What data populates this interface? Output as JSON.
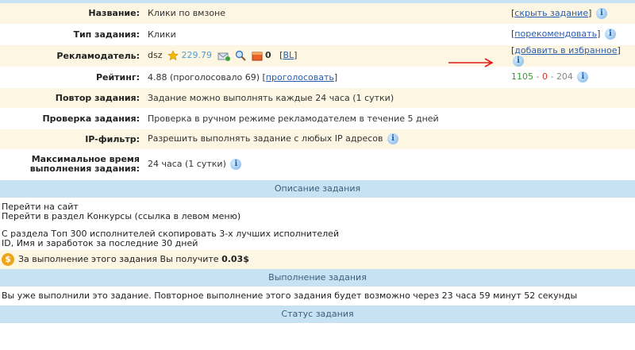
{
  "rows": {
    "name": {
      "label": "Название:",
      "value": "Клики по вмзоне",
      "action": "скрыть задание"
    },
    "type": {
      "label": "Тип задания:",
      "value": "Клики",
      "action": "порекомендовать"
    },
    "advertiser": {
      "label": "Рекламодатель:",
      "name": "dsz",
      "rating": "229.79",
      "count": "0",
      "bl": "BL",
      "action": "добавить в избранное"
    },
    "rating": {
      "label": "Рейтинг:",
      "value": "4.88 (проголосовало 69) [",
      "vote": "проголосовать",
      "close": "]",
      "pos": "1105",
      "sep1": " - ",
      "zero": "0",
      "sep2": " - ",
      "neg": "204"
    },
    "repeat": {
      "label": "Повтор задания:",
      "value": "Задание можно выполнять каждые 24 часа (1 сутки)"
    },
    "check": {
      "label": "Проверка задания:",
      "value": "Проверка в ручном режиме рекламодателем в течение 5 дней"
    },
    "ip": {
      "label": "IP-фильтр:",
      "value": "Разрешить выполнять задание с любых IP адресов"
    },
    "maxtime": {
      "label1": "Максимальное время",
      "label2": "выполнения задания:",
      "value": "24 часа (1 сутки)"
    }
  },
  "sections": {
    "description": "Описание задания",
    "execution": "Выполнение задания",
    "status": "Статус задания"
  },
  "description": {
    "line1": "Перейти на сайт",
    "line2": "Перейти в раздел Конкурсы (ссылка в левом меню)",
    "line3": "С раздела Топ 300 исполнителей скопировать 3-х лучших исполнителей",
    "line4": "ID, Имя и заработок за последние 30 дней"
  },
  "reward": {
    "text": "За выполнение этого задания Вы получите ",
    "amount": "0.03$"
  },
  "execution_msg": "Вы уже выполнили это задание. Повторное выполнение этого задания будет возможно через 23 часа 59 минут 52 секунды",
  "icons": {
    "info": "info-icon",
    "star": "star-icon",
    "coin": "coin-icon"
  },
  "colors": {
    "section_bg": "#c7e3f3",
    "odd_row": "#fdf6e3",
    "link": "#2a5db0"
  }
}
